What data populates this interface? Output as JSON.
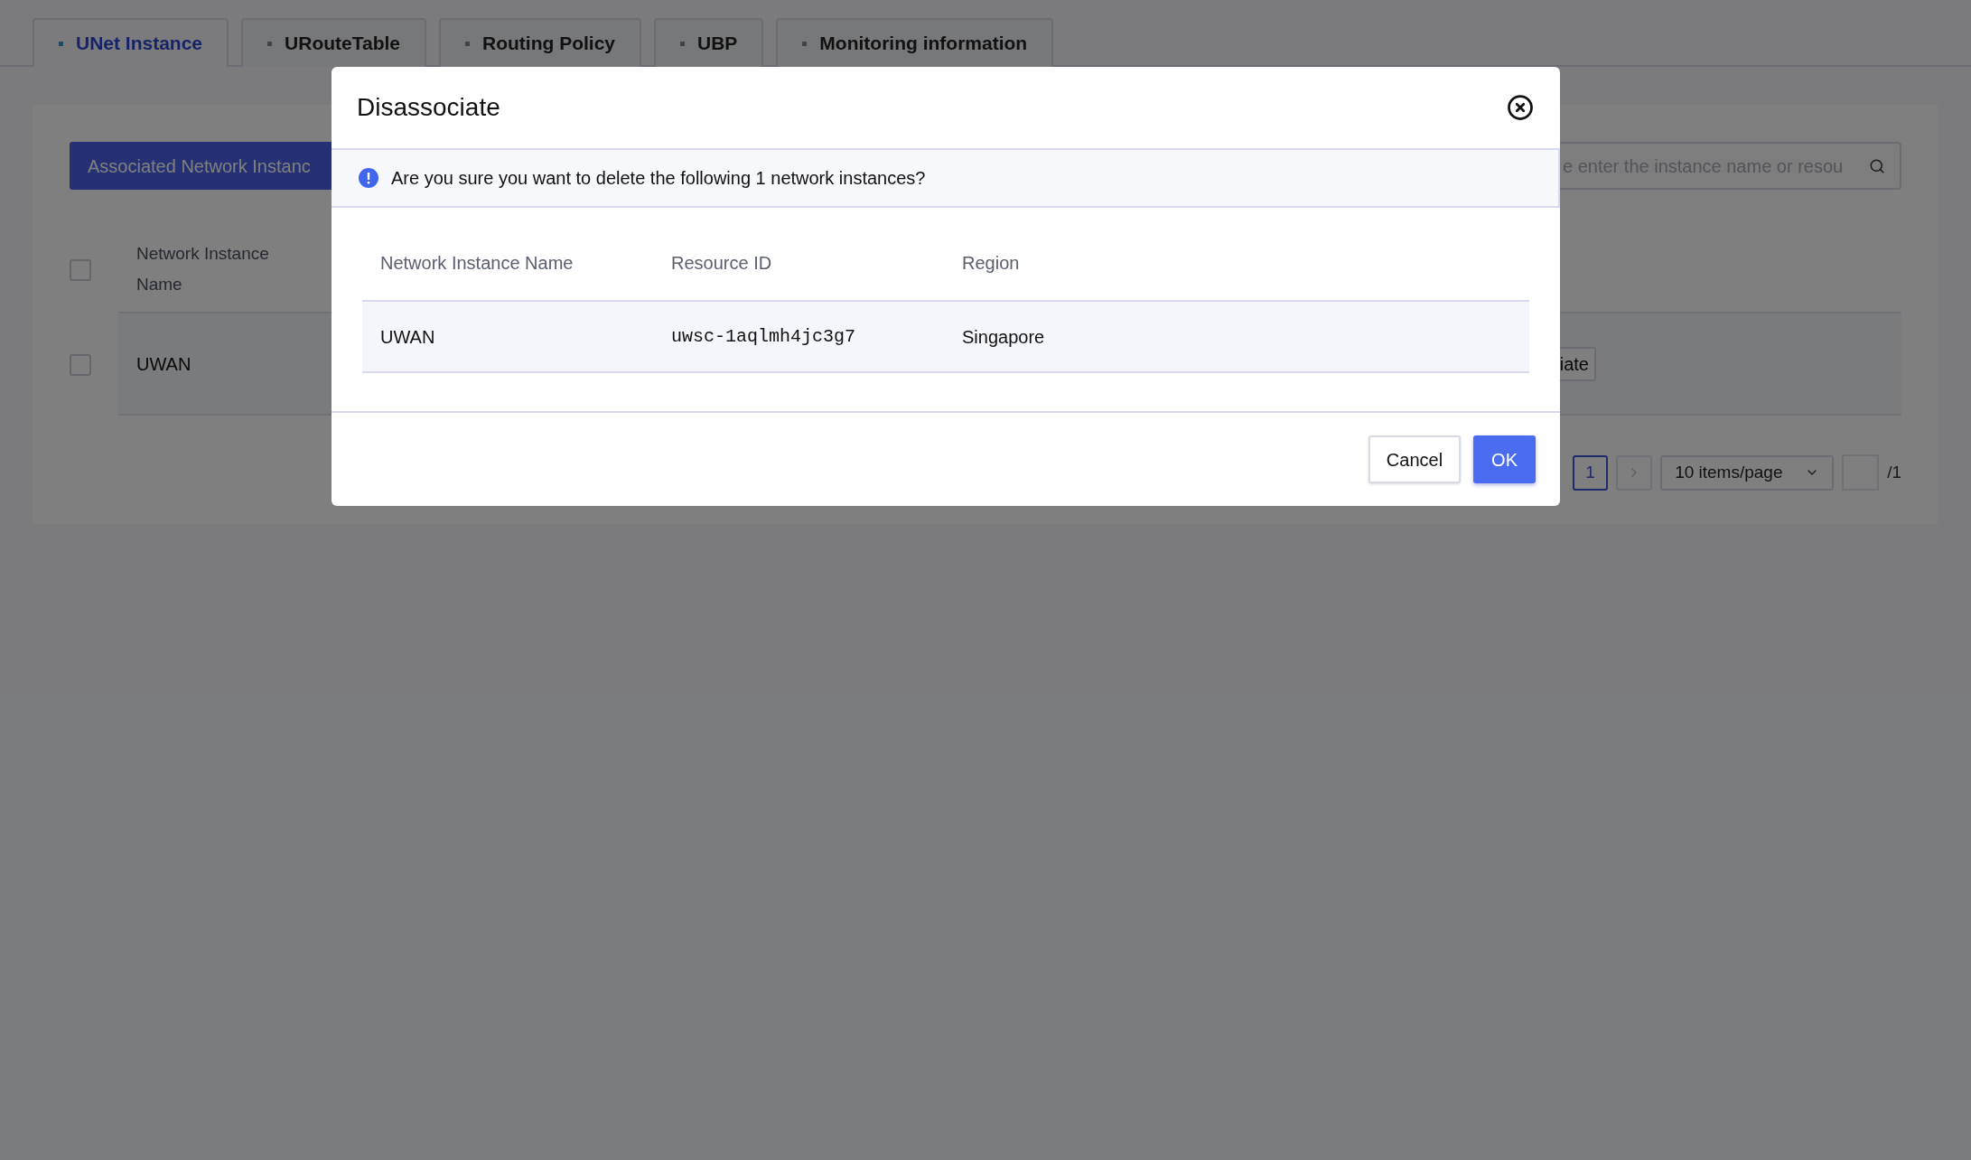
{
  "tabs": [
    {
      "label": "UNet Instance",
      "selected": true
    },
    {
      "label": "URouteTable",
      "selected": false
    },
    {
      "label": "Routing Policy",
      "selected": false
    },
    {
      "label": "UBP",
      "selected": false
    },
    {
      "label": "Monitoring information",
      "selected": false
    }
  ],
  "toolbar": {
    "button": "Associated Network Instanc",
    "search": {
      "placeholder": "e enter the instance name or resou"
    }
  },
  "table": {
    "header_checkbox": {
      "checked": false
    },
    "columns": [
      "Network Instance Name"
    ],
    "rows": [
      {
        "checked": false,
        "name": "UWAN",
        "action": "iate"
      }
    ]
  },
  "pagination": {
    "current_page": "1",
    "page_size": "10 items/page",
    "total": "/1"
  },
  "dialog": {
    "title": "Disassociate",
    "message": "Are you sure you want to delete the following 1 network instances?",
    "columns": [
      "Network Instance Name",
      "Resource ID",
      "Region"
    ],
    "rows": [
      {
        "name": "UWAN",
        "resource_id": "uwsc-1aqlmh4jc3g7",
        "region": "Singapore"
      }
    ],
    "buttons": [
      {
        "label": "Cancel",
        "kind": "secondary"
      },
      {
        "label": "OK",
        "kind": "primary"
      }
    ]
  }
}
